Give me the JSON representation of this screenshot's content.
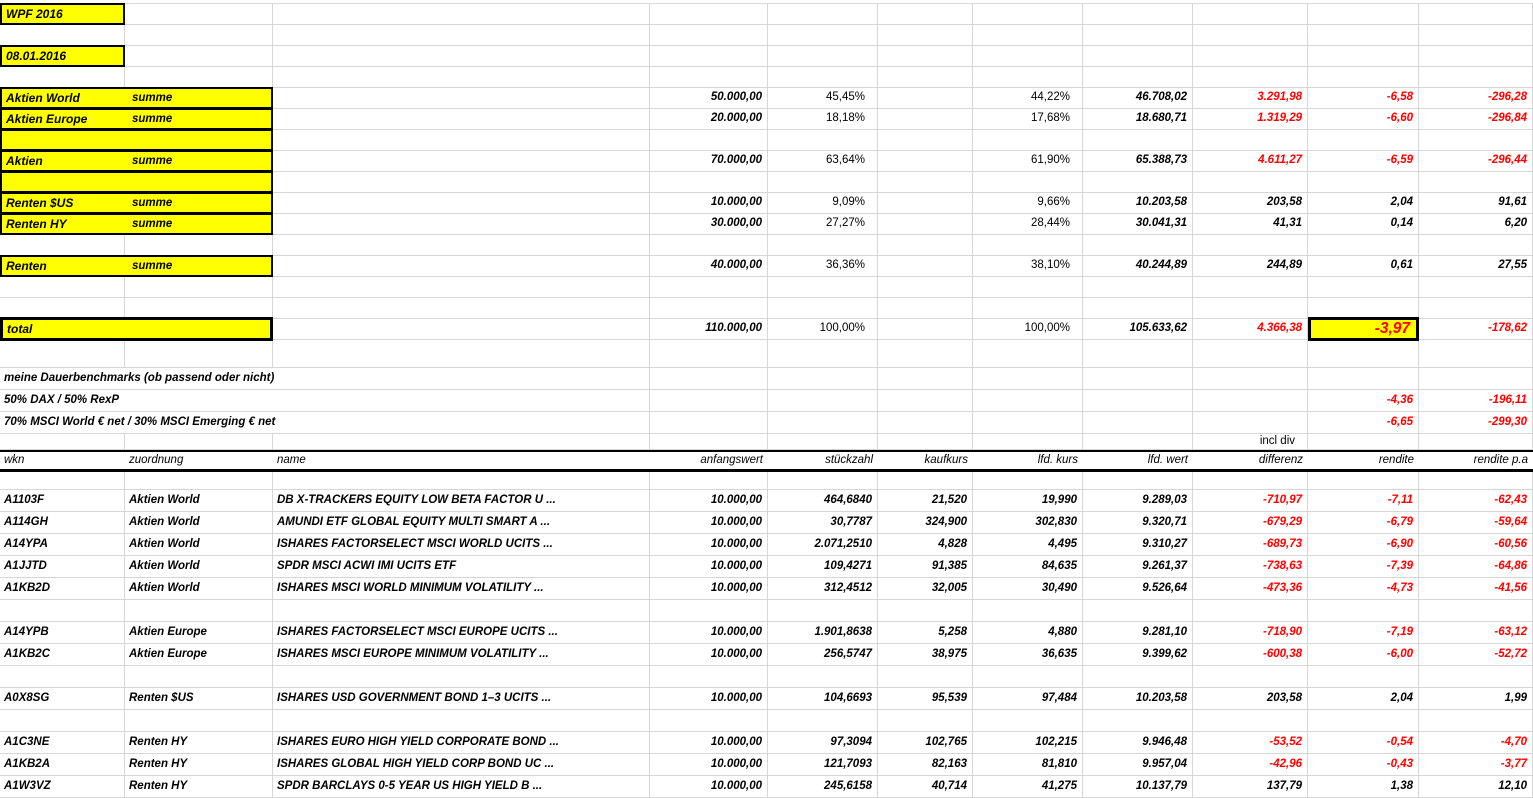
{
  "colors": {
    "highlight": "#ffff00",
    "negative": "#ff0000",
    "gridline": "#d6d6d6",
    "border": "#000000"
  },
  "title_box": "WPF 2016",
  "date_box": "08.01.2016",
  "summary": {
    "rows": [
      {
        "label": "Aktien World",
        "sublabel": "summe",
        "anfangswert": "50.000,00",
        "anteil_plan": "45,45%",
        "anteil_ist": "44,22%",
        "lfd_wert": "46.708,02",
        "differenz": "3.291,98",
        "rendite": "-6,58",
        "rendite_pa": "-296,28",
        "red_values": true
      },
      {
        "label": "Aktien Europe",
        "sublabel": "summe",
        "anfangswert": "20.000,00",
        "anteil_plan": "18,18%",
        "anteil_ist": "17,68%",
        "lfd_wert": "18.680,71",
        "differenz": "1.319,29",
        "rendite": "-6,60",
        "rendite_pa": "-296,84",
        "red_values": true
      },
      {
        "spacer": true
      },
      {
        "label": "Aktien",
        "sublabel": "summe",
        "anfangswert": "70.000,00",
        "anteil_plan": "63,64%",
        "anteil_ist": "61,90%",
        "lfd_wert": "65.388,73",
        "differenz": "4.611,27",
        "rendite": "-6,59",
        "rendite_pa": "-296,44",
        "red_values": true
      },
      {
        "spacer": true
      },
      {
        "label": "Renten $US",
        "sublabel": "summe",
        "anfangswert": "10.000,00",
        "anteil_plan": "9,09%",
        "anteil_ist": "9,66%",
        "lfd_wert": "10.203,58",
        "differenz": "203,58",
        "rendite": "2,04",
        "rendite_pa": "91,61",
        "red_values": false
      },
      {
        "label": "Renten HY",
        "sublabel": "summe",
        "anfangswert": "30.000,00",
        "anteil_plan": "27,27%",
        "anteil_ist": "28,44%",
        "lfd_wert": "30.041,31",
        "differenz": "41,31",
        "rendite": "0,14",
        "rendite_pa": "6,20",
        "red_values": false
      }
    ],
    "renten_total": {
      "label": "Renten",
      "sublabel": "summe",
      "anfangswert": "40.000,00",
      "anteil_plan": "36,36%",
      "anteil_ist": "38,10%",
      "lfd_wert": "40.244,89",
      "differenz": "244,89",
      "rendite": "0,61",
      "rendite_pa": "27,55",
      "red_values": false
    },
    "grand_total": {
      "label": "total",
      "anfangswert": "110.000,00",
      "anteil_plan": "100,00%",
      "anteil_ist": "100,00%",
      "lfd_wert": "105.633,62",
      "differenz": "4.366,38",
      "rendite": "-3,97",
      "rendite_pa": "-178,62"
    }
  },
  "benchmarks": {
    "title": "meine Dauerbenchmarks (ob passend oder nicht)",
    "rows": [
      {
        "name": "50% DAX / 50% RexP",
        "rendite": "-4,36",
        "rendite_pa": "-196,11"
      },
      {
        "name": "70% MSCI World € net / 30% MSCI Emerging € net",
        "rendite": "-6,65",
        "rendite_pa": "-299,30"
      }
    ],
    "incl_div_note": "incl div"
  },
  "table": {
    "headers": [
      "wkn",
      "zuordnung",
      "name",
      "anfangswert",
      "stückzahl",
      "kaufkurs",
      "lfd. kurs",
      "lfd. wert",
      "differenz",
      "rendite",
      "rendite p.a"
    ],
    "positions": [
      {
        "wkn": "A1103F",
        "zuordnung": "Aktien World",
        "name": "DB X-TRACKERS EQUITY LOW BETA FACTOR U ...",
        "anfangswert": "10.000,00",
        "stueckzahl": "464,6840",
        "kaufkurs": "21,520",
        "lfd_kurs": "19,990",
        "lfd_wert": "9.289,03",
        "differenz": "-710,97",
        "rendite": "-7,11",
        "rendite_pa": "-62,43"
      },
      {
        "wkn": "A114GH",
        "zuordnung": "Aktien World",
        "name": "AMUNDI ETF GLOBAL EQUITY MULTI SMART A ...",
        "anfangswert": "10.000,00",
        "stueckzahl": "30,7787",
        "kaufkurs": "324,900",
        "lfd_kurs": "302,830",
        "lfd_wert": "9.320,71",
        "differenz": "-679,29",
        "rendite": "-6,79",
        "rendite_pa": "-59,64"
      },
      {
        "wkn": "A14YPA",
        "zuordnung": "Aktien World",
        "name": "ISHARES FACTORSELECT MSCI WORLD UCITS ...",
        "anfangswert": "10.000,00",
        "stueckzahl": "2.071,2510",
        "kaufkurs": "4,828",
        "lfd_kurs": "4,495",
        "lfd_wert": "9.310,27",
        "differenz": "-689,73",
        "rendite": "-6,90",
        "rendite_pa": "-60,56"
      },
      {
        "wkn": "A1JJTD",
        "zuordnung": "Aktien World",
        "name": "SPDR MSCI ACWI IMI UCITS ETF",
        "anfangswert": "10.000,00",
        "stueckzahl": "109,4271",
        "kaufkurs": "91,385",
        "lfd_kurs": "84,635",
        "lfd_wert": "9.261,37",
        "differenz": "-738,63",
        "rendite": "-7,39",
        "rendite_pa": "-64,86"
      },
      {
        "wkn": "A1KB2D",
        "zuordnung": "Aktien World",
        "name": "ISHARES MSCI WORLD MINIMUM VOLATILITY ...",
        "anfangswert": "10.000,00",
        "stueckzahl": "312,4512",
        "kaufkurs": "32,005",
        "lfd_kurs": "30,490",
        "lfd_wert": "9.526,64",
        "differenz": "-473,36",
        "rendite": "-4,73",
        "rendite_pa": "-41,56"
      },
      {
        "wkn": "A14YPB",
        "zuordnung": "Aktien Europe",
        "name": "ISHARES FACTORSELECT MSCI EUROPE UCITS ...",
        "anfangswert": "10.000,00",
        "stueckzahl": "1.901,8638",
        "kaufkurs": "5,258",
        "lfd_kurs": "4,880",
        "lfd_wert": "9.281,10",
        "differenz": "-718,90",
        "rendite": "-7,19",
        "rendite_pa": "-63,12"
      },
      {
        "wkn": "A1KB2C",
        "zuordnung": "Aktien Europe",
        "name": "ISHARES MSCI EUROPE MINIMUM VOLATILITY ...",
        "anfangswert": "10.000,00",
        "stueckzahl": "256,5747",
        "kaufkurs": "38,975",
        "lfd_kurs": "36,635",
        "lfd_wert": "9.399,62",
        "differenz": "-600,38",
        "rendite": "-6,00",
        "rendite_pa": "-52,72"
      },
      {
        "wkn": "A0X8SG",
        "zuordnung": "Renten $US",
        "name": "ISHARES USD GOVERNMENT BOND 1–3 UCITS ...",
        "anfangswert": "10.000,00",
        "stueckzahl": "104,6693",
        "kaufkurs": "95,539",
        "lfd_kurs": "97,484",
        "lfd_wert": "10.203,58",
        "differenz": "203,58",
        "rendite": "2,04",
        "rendite_pa": "1,99"
      },
      {
        "wkn": "A1C3NE",
        "zuordnung": "Renten HY",
        "name": "ISHARES EURO HIGH YIELD CORPORATE BOND ...",
        "anfangswert": "10.000,00",
        "stueckzahl": "97,3094",
        "kaufkurs": "102,765",
        "lfd_kurs": "102,215",
        "lfd_wert": "9.946,48",
        "differenz": "-53,52",
        "rendite": "-0,54",
        "rendite_pa": "-4,70"
      },
      {
        "wkn": "A1KB2A",
        "zuordnung": "Renten HY",
        "name": "ISHARES GLOBAL HIGH YIELD CORP BOND UC ...",
        "anfangswert": "10.000,00",
        "stueckzahl": "121,7093",
        "kaufkurs": "82,163",
        "lfd_kurs": "81,810",
        "lfd_wert": "9.957,04",
        "differenz": "-42,96",
        "rendite": "-0,43",
        "rendite_pa": "-3,77"
      },
      {
        "wkn": "A1W3VZ",
        "zuordnung": "Renten HY",
        "name": "SPDR BARCLAYS 0-5 YEAR US HIGH YIELD B ...",
        "anfangswert": "10.000,00",
        "stueckzahl": "245,6158",
        "kaufkurs": "40,714",
        "lfd_kurs": "41,275",
        "lfd_wert": "10.137,79",
        "differenz": "137,79",
        "rendite": "1,38",
        "rendite_pa": "12,10"
      }
    ]
  }
}
